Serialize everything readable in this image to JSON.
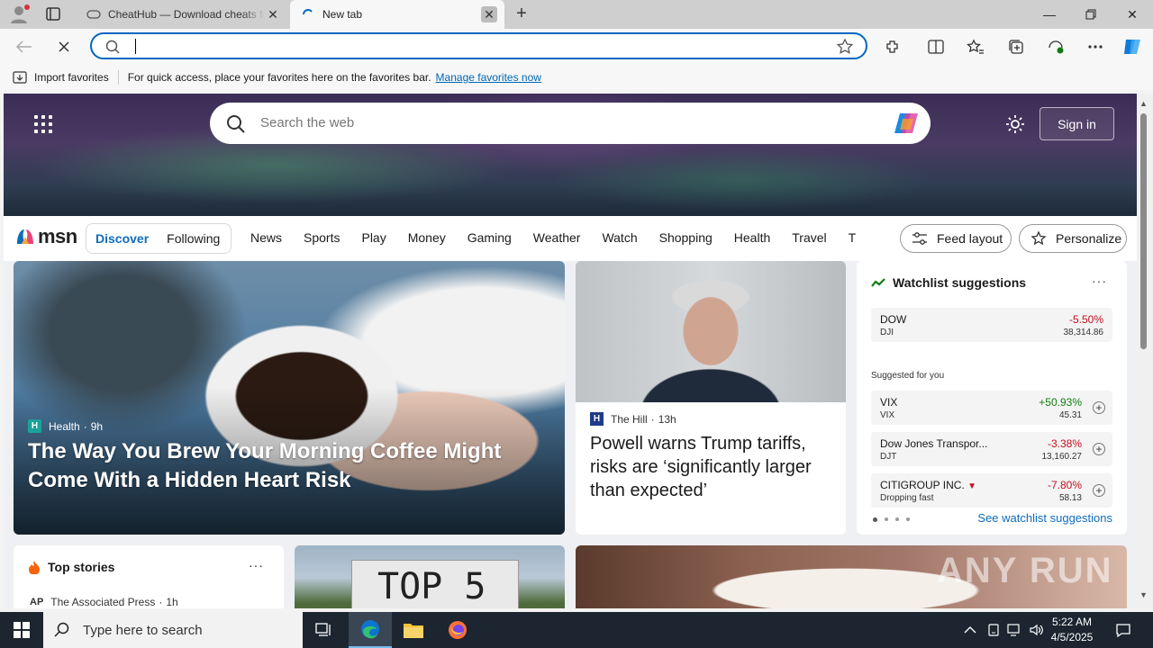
{
  "browser": {
    "tabs": [
      {
        "title": "CheatHub — Download cheats for games"
      },
      {
        "title": "New tab"
      }
    ],
    "address": {
      "value": "",
      "placeholder": ""
    },
    "favorites_bar": {
      "import_label": "Import favorites",
      "hint": "For quick access, place your favorites here on the favorites bar.",
      "manage_link": "Manage favorites now"
    }
  },
  "msn": {
    "search_placeholder": "Search the web",
    "sign_in": "Sign in",
    "logo_text": "msn",
    "tabs": {
      "discover": "Discover",
      "following": "Following"
    },
    "nav": [
      "News",
      "Sports",
      "Play",
      "Money",
      "Gaming",
      "Weather",
      "Watch",
      "Shopping",
      "Health",
      "Travel",
      "Traffic"
    ],
    "feed_layout": "Feed layout",
    "personalize": "Personalize"
  },
  "cards": {
    "big": {
      "source": "Health",
      "age": "9h",
      "headline": "The Way You Brew Your Morning Coffee Might Come With a Hidden Heart Risk"
    },
    "powell": {
      "source": "The Hill",
      "age": "13h",
      "headline": "Powell warns Trump tariffs, risks are ‘significantly larger than expected’"
    },
    "top_stories": {
      "title": "Top stories",
      "source": "The Associated Press",
      "age": "1h"
    },
    "top5": {
      "sign": "TOP 5"
    }
  },
  "watchlist": {
    "title": "Watchlist suggestions",
    "suggested_label": "Suggested for you",
    "see_all": "See watchlist suggestions",
    "main": {
      "name": "DOW",
      "ticker": "DJI",
      "change": "-5.50%",
      "price": "38,314.86"
    },
    "suggestions": [
      {
        "name": "VIX",
        "ticker": "VIX",
        "change": "+50.93%",
        "price": "45.31"
      },
      {
        "name": "Dow Jones Transpor...",
        "ticker": "DJT",
        "change": "-3.38%",
        "price": "13,160.27"
      },
      {
        "name": "CITIGROUP INC.",
        "ticker": "Dropping fast",
        "change": "-7.80%",
        "price": "58.13"
      }
    ]
  },
  "watermark": "ANY RUN",
  "taskbar": {
    "search_placeholder": "Type here to search",
    "time": "5:22 AM",
    "date": "4/5/2025"
  }
}
